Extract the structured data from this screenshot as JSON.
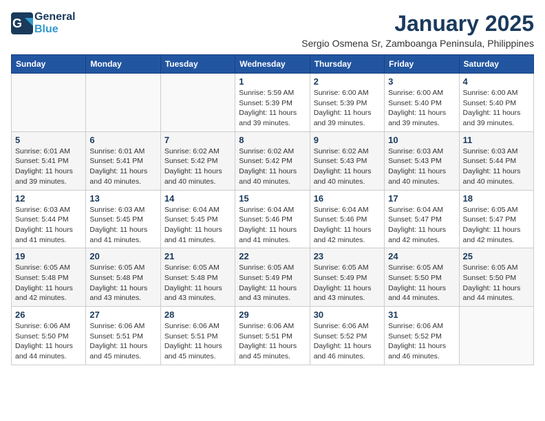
{
  "header": {
    "logo_general": "General",
    "logo_blue": "Blue",
    "title": "January 2025",
    "subtitle": "Sergio Osmena Sr, Zamboanga Peninsula, Philippines"
  },
  "weekdays": [
    "Sunday",
    "Monday",
    "Tuesday",
    "Wednesday",
    "Thursday",
    "Friday",
    "Saturday"
  ],
  "weeks": [
    [
      {
        "day": "",
        "details": ""
      },
      {
        "day": "",
        "details": ""
      },
      {
        "day": "",
        "details": ""
      },
      {
        "day": "1",
        "details": "Sunrise: 5:59 AM\nSunset: 5:39 PM\nDaylight: 11 hours and 39 minutes."
      },
      {
        "day": "2",
        "details": "Sunrise: 6:00 AM\nSunset: 5:39 PM\nDaylight: 11 hours and 39 minutes."
      },
      {
        "day": "3",
        "details": "Sunrise: 6:00 AM\nSunset: 5:40 PM\nDaylight: 11 hours and 39 minutes."
      },
      {
        "day": "4",
        "details": "Sunrise: 6:00 AM\nSunset: 5:40 PM\nDaylight: 11 hours and 39 minutes."
      }
    ],
    [
      {
        "day": "5",
        "details": "Sunrise: 6:01 AM\nSunset: 5:41 PM\nDaylight: 11 hours and 39 minutes."
      },
      {
        "day": "6",
        "details": "Sunrise: 6:01 AM\nSunset: 5:41 PM\nDaylight: 11 hours and 40 minutes."
      },
      {
        "day": "7",
        "details": "Sunrise: 6:02 AM\nSunset: 5:42 PM\nDaylight: 11 hours and 40 minutes."
      },
      {
        "day": "8",
        "details": "Sunrise: 6:02 AM\nSunset: 5:42 PM\nDaylight: 11 hours and 40 minutes."
      },
      {
        "day": "9",
        "details": "Sunrise: 6:02 AM\nSunset: 5:43 PM\nDaylight: 11 hours and 40 minutes."
      },
      {
        "day": "10",
        "details": "Sunrise: 6:03 AM\nSunset: 5:43 PM\nDaylight: 11 hours and 40 minutes."
      },
      {
        "day": "11",
        "details": "Sunrise: 6:03 AM\nSunset: 5:44 PM\nDaylight: 11 hours and 40 minutes."
      }
    ],
    [
      {
        "day": "12",
        "details": "Sunrise: 6:03 AM\nSunset: 5:44 PM\nDaylight: 11 hours and 41 minutes."
      },
      {
        "day": "13",
        "details": "Sunrise: 6:03 AM\nSunset: 5:45 PM\nDaylight: 11 hours and 41 minutes."
      },
      {
        "day": "14",
        "details": "Sunrise: 6:04 AM\nSunset: 5:45 PM\nDaylight: 11 hours and 41 minutes."
      },
      {
        "day": "15",
        "details": "Sunrise: 6:04 AM\nSunset: 5:46 PM\nDaylight: 11 hours and 41 minutes."
      },
      {
        "day": "16",
        "details": "Sunrise: 6:04 AM\nSunset: 5:46 PM\nDaylight: 11 hours and 42 minutes."
      },
      {
        "day": "17",
        "details": "Sunrise: 6:04 AM\nSunset: 5:47 PM\nDaylight: 11 hours and 42 minutes."
      },
      {
        "day": "18",
        "details": "Sunrise: 6:05 AM\nSunset: 5:47 PM\nDaylight: 11 hours and 42 minutes."
      }
    ],
    [
      {
        "day": "19",
        "details": "Sunrise: 6:05 AM\nSunset: 5:48 PM\nDaylight: 11 hours and 42 minutes."
      },
      {
        "day": "20",
        "details": "Sunrise: 6:05 AM\nSunset: 5:48 PM\nDaylight: 11 hours and 43 minutes."
      },
      {
        "day": "21",
        "details": "Sunrise: 6:05 AM\nSunset: 5:48 PM\nDaylight: 11 hours and 43 minutes."
      },
      {
        "day": "22",
        "details": "Sunrise: 6:05 AM\nSunset: 5:49 PM\nDaylight: 11 hours and 43 minutes."
      },
      {
        "day": "23",
        "details": "Sunrise: 6:05 AM\nSunset: 5:49 PM\nDaylight: 11 hours and 43 minutes."
      },
      {
        "day": "24",
        "details": "Sunrise: 6:05 AM\nSunset: 5:50 PM\nDaylight: 11 hours and 44 minutes."
      },
      {
        "day": "25",
        "details": "Sunrise: 6:05 AM\nSunset: 5:50 PM\nDaylight: 11 hours and 44 minutes."
      }
    ],
    [
      {
        "day": "26",
        "details": "Sunrise: 6:06 AM\nSunset: 5:50 PM\nDaylight: 11 hours and 44 minutes."
      },
      {
        "day": "27",
        "details": "Sunrise: 6:06 AM\nSunset: 5:51 PM\nDaylight: 11 hours and 45 minutes."
      },
      {
        "day": "28",
        "details": "Sunrise: 6:06 AM\nSunset: 5:51 PM\nDaylight: 11 hours and 45 minutes."
      },
      {
        "day": "29",
        "details": "Sunrise: 6:06 AM\nSunset: 5:51 PM\nDaylight: 11 hours and 45 minutes."
      },
      {
        "day": "30",
        "details": "Sunrise: 6:06 AM\nSunset: 5:52 PM\nDaylight: 11 hours and 46 minutes."
      },
      {
        "day": "31",
        "details": "Sunrise: 6:06 AM\nSunset: 5:52 PM\nDaylight: 11 hours and 46 minutes."
      },
      {
        "day": "",
        "details": ""
      }
    ]
  ]
}
